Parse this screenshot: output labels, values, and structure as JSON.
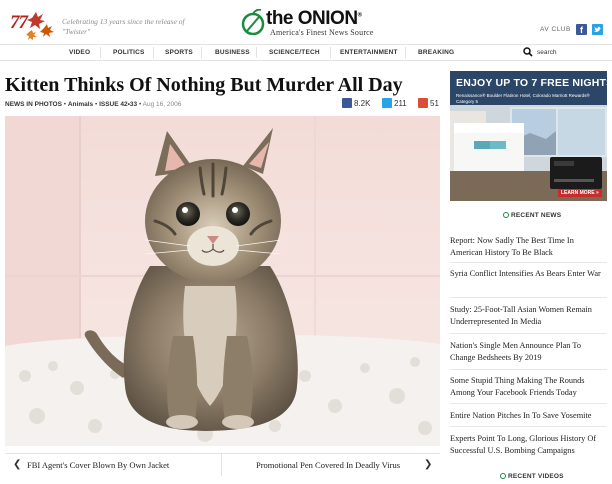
{
  "header": {
    "anniversary_number": "77",
    "celebrating_line1": "Celebrating 13 years since the release of",
    "celebrating_line2": "\"Twister\"",
    "site_name": "the ONION",
    "registered_mark": "®",
    "tagline": "America's Finest News Source",
    "avclub_label": "AV CLUB",
    "facebook_glyph": "f"
  },
  "nav": {
    "items": [
      "VIDEO",
      "POLITICS",
      "SPORTS",
      "BUSINESS",
      "SCIENCE/TECH",
      "ENTERTAINMENT",
      "BREAKING"
    ],
    "search_label": "search"
  },
  "article": {
    "headline": "Kitten Thinks Of Nothing But Murder All Day",
    "section": "NEWS IN PHOTOS",
    "category": "Animals",
    "issue": "ISSUE 42•33",
    "date": "Aug 16, 2006",
    "separator": "•",
    "shares": {
      "facebook": "8.2K",
      "twitter": "211",
      "googleplus": "51"
    }
  },
  "pager": {
    "prev_arrow": "❮",
    "prev_title": "FBI Agent's Cover Blown By Own Jacket",
    "next_title": "Promotional Pen Covered In Deadly Virus",
    "next_arrow": "❯"
  },
  "ad": {
    "headline": "ENJOY UP TO 7 FREE NIGHTS.",
    "subtext": "Renaissance® Boulder Flatiron Hotel, Colorado Marriott Rewards® Category 5",
    "cta": "LEARN MORE »"
  },
  "sidebar": {
    "recent_news_title": "RECENT NEWS",
    "recent_news": [
      "Report: Now Sadly The Best Time In American History To Be Black",
      "Syria Conflict Intensifies As Bears Enter War",
      "Study: 25-Foot-Tall Asian Women Remain Underrepresented In Media",
      "Nation's Single Men Announce Plan To Change Bedsheets By 2019",
      "Some Stupid Thing Making The Rounds Among Your Facebook Friends Today",
      "Entire Nation Pitches In To Save Yosemite",
      "Experts Point To Long, Glorious History Of Successful U.S. Bombing Campaigns"
    ],
    "recent_videos_title": "RECENT VIDEOS"
  },
  "colors": {
    "onion_green": "#1a8b3f",
    "anniversary_red": "#b5241c",
    "facebook_blue": "#3b5998",
    "twitter_blue": "#2aa3e6",
    "googleplus_red": "#dd4b39"
  }
}
